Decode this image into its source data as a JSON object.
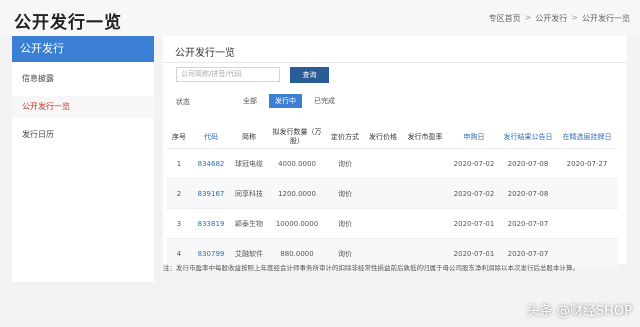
{
  "header": {
    "title": "公开发行一览",
    "breadcrumb": [
      "专区首页",
      "公开发行",
      "公开发行一览"
    ]
  },
  "sidebar": {
    "title": "公开发行",
    "items": [
      {
        "label": "信息披露",
        "active": false
      },
      {
        "label": "公开发行一览",
        "active": true
      },
      {
        "label": "发行日历",
        "active": false
      }
    ]
  },
  "main": {
    "title": "公开发行一览",
    "search": {
      "placeholder": "公司简称/拼音/代码",
      "button": "查询"
    },
    "status": {
      "label": "状态",
      "options": [
        {
          "label": "全部",
          "active": false
        },
        {
          "label": "发行中",
          "active": true
        },
        {
          "label": "已完成",
          "active": false
        }
      ]
    },
    "table": {
      "headers": [
        "序号",
        "代码",
        "简称",
        "拟发行数量（万股）",
        "定价方式",
        "发行价格",
        "发行市盈率",
        "申购日",
        "发行结果公告日",
        "在精选层挂牌日"
      ],
      "rows": [
        [
          "1",
          "834682",
          "球冠电缆",
          "4000.0000",
          "询价",
          "",
          "",
          "2020-07-02",
          "2020-07-08",
          "2020-07-27"
        ],
        [
          "2",
          "839167",
          "同享科技",
          "1200.0000",
          "询价",
          "",
          "",
          "2020-07-02",
          "2020-07-08",
          ""
        ],
        [
          "3",
          "833819",
          "颖泰生物",
          "10000.0000",
          "询价",
          "",
          "",
          "2020-07-01",
          "2020-07-07",
          ""
        ],
        [
          "4",
          "830799",
          "艾融软件",
          "880.0000",
          "询价",
          "",
          "",
          "2020-07-01",
          "2020-07-07",
          ""
        ]
      ]
    }
  },
  "note": "注：发行市盈率中每股收益按照上年度经会计师事务所审计的扣除非经常性损益前后孰低的归属于母公司股东净利润除以本次发行后总股本计算。",
  "watermark": "头条 @财经SHOP",
  "colors": {
    "accent": "#3a7fd3",
    "button": "#2a5d96",
    "link": "#2f6db5",
    "active_side": "#c0392b"
  }
}
